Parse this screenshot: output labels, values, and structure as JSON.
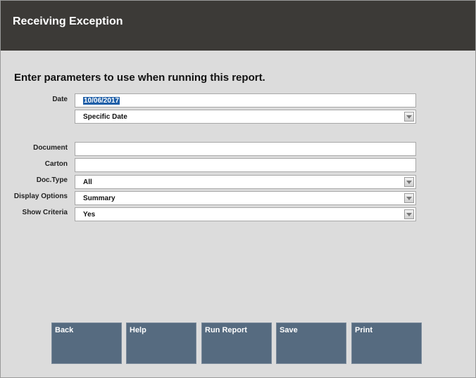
{
  "window": {
    "title": "Receiving Exception"
  },
  "form": {
    "instruction": "Enter parameters to use when running this report.",
    "date_label": "Date",
    "date_value": "10/06/2017",
    "date_mode": "Specific Date",
    "document_label": "Document",
    "document_value": "",
    "carton_label": "Carton",
    "carton_value": "",
    "doctype_label": "Doc.Type",
    "doctype_value": "All",
    "display_label": "Display Options",
    "display_value": "Summary",
    "criteria_label": "Show Criteria",
    "criteria_value": "Yes"
  },
  "buttons": {
    "back": "Back",
    "help": "Help",
    "run": "Run Report",
    "save": "Save",
    "print": "Print"
  },
  "colors": {
    "titlebar": "#3c3a37",
    "background": "#dcdcdc",
    "button": "#566b80",
    "selection": "#1f5fa8"
  }
}
